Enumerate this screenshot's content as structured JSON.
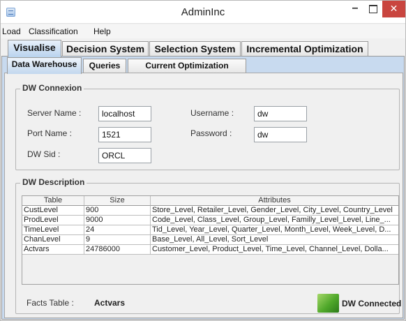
{
  "window": {
    "title": "AdminInc",
    "minimize": "–",
    "close": "✕"
  },
  "menu": [
    "Load",
    "Classification",
    "Help"
  ],
  "main_tabs": [
    "Visualise",
    "Decision System",
    "Selection System",
    "Incremental Optimization"
  ],
  "sub_tabs": [
    "Data Warehouse",
    "Queries",
    "Current Optimization Schema"
  ],
  "connexion": {
    "title": "DW Connexion",
    "server_name_label": "Server Name :",
    "server_name_value": "localhost",
    "port_name_label": "Port Name :",
    "port_name_value": "1521",
    "dw_sid_label": "DW Sid :",
    "dw_sid_value": "ORCL",
    "username_label": "Username :",
    "username_value": "dw",
    "password_label": "Password :",
    "password_value": "dw"
  },
  "description": {
    "title": "DW Description",
    "columns": [
      "Table",
      "Size",
      "Attributes"
    ],
    "rows": [
      [
        "CustLevel",
        "900",
        "Store_Level, Retailer_Level, Gender_Level, City_Level, Country_Level"
      ],
      [
        "ProdLevel",
        "9000",
        "Code_Level, Class_Level, Group_Level, Familly_Level_Level, Line_..."
      ],
      [
        "TimeLevel",
        "24",
        "Tid_Level, Year_Level, Quarter_Level, Month_Level, Week_Level, D..."
      ],
      [
        "ChanLevel",
        "9",
        "Base_Level, All_Level, Sort_Level"
      ],
      [
        "Actvars",
        "24786000",
        "Customer_Level, Product_Level, Time_Level, Channel_Level, Dolla..."
      ]
    ],
    "facts_label": "Facts Table :",
    "facts_value": "Actvars",
    "status": "DW Connected"
  },
  "colors": {
    "active_tab": "#b9d3ee",
    "panel": "#c8daef",
    "close_button": "#c9453f",
    "status_icon": "#4fa82a"
  }
}
